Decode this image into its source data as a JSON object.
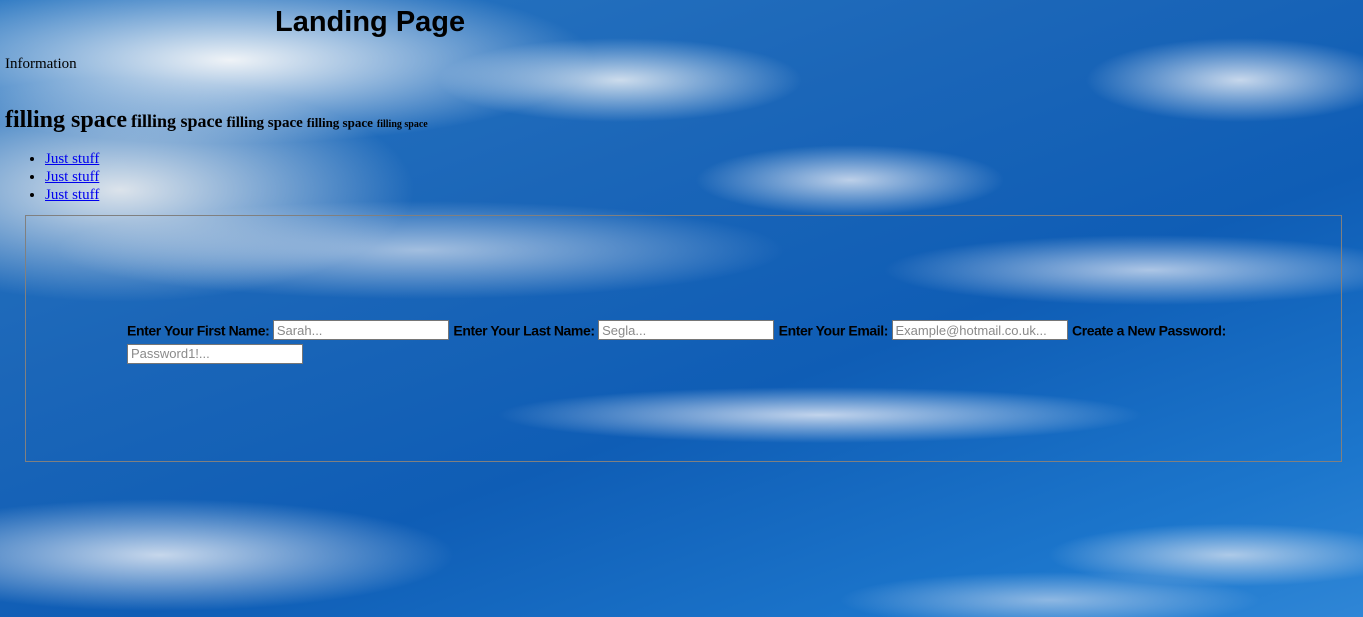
{
  "header": {
    "title": "Landing Page"
  },
  "info": {
    "text": "Information"
  },
  "filler": {
    "items": [
      "filling space",
      "filling space",
      "filling space",
      "filling space",
      "filling space"
    ]
  },
  "nav": {
    "links": [
      "Just stuff",
      "Just stuff",
      "Just stuff"
    ]
  },
  "form": {
    "first_name_label": "Enter Your First Name:",
    "first_name_placeholder": "Sarah...",
    "first_name_value": "",
    "last_name_label": "Enter Your Last Name:",
    "last_name_placeholder": "Segla...",
    "last_name_value": "",
    "email_label": "Enter Your Email:",
    "email_placeholder": "Example@hotmail.co.uk...",
    "email_value": "",
    "password_label": "Create a New Password:",
    "password_placeholder": "Password1!...",
    "password_value": ""
  },
  "colors": {
    "link": "#0000ee",
    "border": "#808080",
    "sky": "#1b66b8"
  }
}
